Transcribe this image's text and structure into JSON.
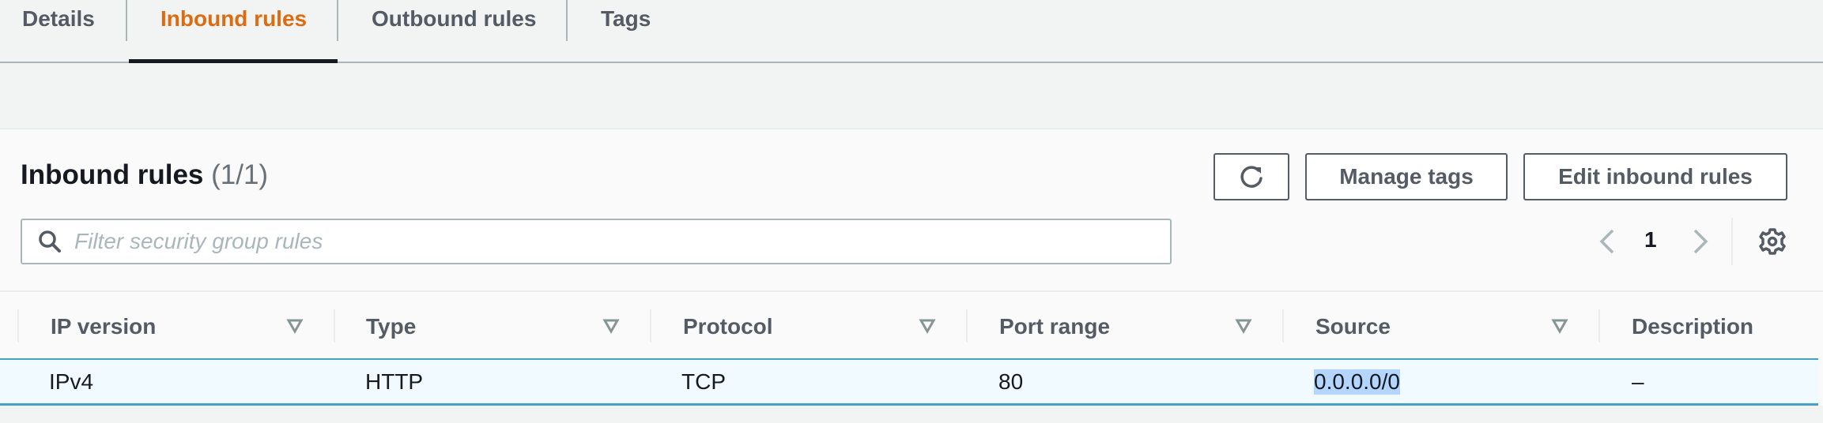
{
  "tabs": [
    {
      "label": "Details",
      "active": false
    },
    {
      "label": "Inbound rules",
      "active": true
    },
    {
      "label": "Outbound rules",
      "active": false
    },
    {
      "label": "Tags",
      "active": false
    }
  ],
  "panel": {
    "title": "Inbound rules",
    "count": "(1/1)",
    "buttons": {
      "refresh_icon": "refresh-icon",
      "manage_tags": "Manage tags",
      "edit_inbound_rules": "Edit inbound rules"
    },
    "search": {
      "placeholder": "Filter security group rules",
      "value": ""
    },
    "pagination": {
      "current_page": "1"
    }
  },
  "table": {
    "columns": [
      "IP version",
      "Type",
      "Protocol",
      "Port range",
      "Source",
      "Description"
    ],
    "rows": [
      {
        "ip_version": "IPv4",
        "type": "HTTP",
        "protocol": "TCP",
        "port_range": "80",
        "source": "0.0.0.0/0",
        "description": "–"
      }
    ]
  },
  "colors": {
    "accent_active_tab": "#dd6b10",
    "selected_row_border": "#44a3c4",
    "selected_row_bg": "#f1faff",
    "text_selection": "#b4d5fe"
  }
}
